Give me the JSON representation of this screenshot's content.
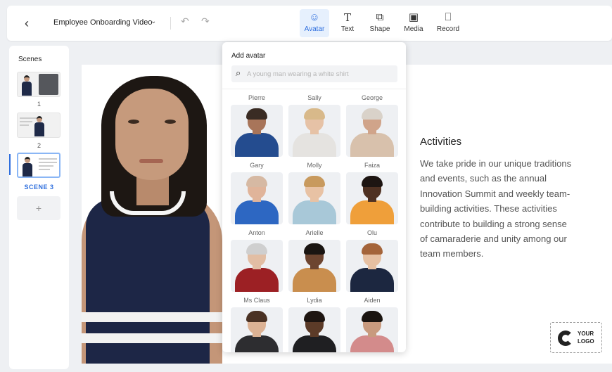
{
  "topbar": {
    "back_icon": "chevron-left-icon",
    "project_title": "Employee Onboarding Video",
    "title_dropdown_icon": "chevron-down-icon",
    "undo_icon": "undo-icon",
    "redo_icon": "redo-icon",
    "tools": [
      {
        "label": "Avatar",
        "icon": "avatar-icon",
        "active": true
      },
      {
        "label": "Text",
        "icon": "text-icon",
        "active": false
      },
      {
        "label": "Shape",
        "icon": "shape-icon",
        "active": false
      },
      {
        "label": "Media",
        "icon": "media-icon",
        "active": false
      },
      {
        "label": "Record",
        "icon": "record-icon",
        "active": false
      }
    ]
  },
  "scenes": {
    "title": "Scenes",
    "items": [
      {
        "label": "1",
        "active": false
      },
      {
        "label": "2",
        "active": false
      },
      {
        "label": "SCENE 3",
        "active": true
      }
    ],
    "add_label": "+",
    "accent_color": "#2f6fde"
  },
  "canvas": {
    "heading": "Activities",
    "body": "We take pride in our unique traditions and events, such as the annual Innovation Summit and weekly team-building activities. These activities contribute to building a strong sense of camaraderie and unity among our team members.",
    "logo_line1": "YOUR",
    "logo_line2": "LOGO"
  },
  "avatar_panel": {
    "title": "Add avatar",
    "search_icon": "search-icon",
    "search_placeholder": "A young man wearing a white shirt",
    "search_value": "",
    "avatars": [
      {
        "name": "Pierre",
        "skin": "#a8755a",
        "hair": "#3a2c24",
        "outfit": "#244c8f"
      },
      {
        "name": "Sally",
        "skin": "#e6c2a6",
        "hair": "#d8b98a",
        "outfit": "#e5e3e0"
      },
      {
        "name": "George",
        "skin": "#d0a48a",
        "hair": "#d9d2c9",
        "outfit": "#d8c1ac"
      },
      {
        "name": "Gary",
        "skin": "#e0b49a",
        "hair": "#d6b9a3",
        "outfit": "#2d67c2"
      },
      {
        "name": "Molly",
        "skin": "#e8c2a4",
        "hair": "#c89a5e",
        "outfit": "#a8c8d8"
      },
      {
        "name": "Faiza",
        "skin": "#4f3122",
        "hair": "#1d1512",
        "outfit": "#ef9f3a"
      },
      {
        "name": "Anton",
        "skin": "#e2bea4",
        "hair": "#cfcfcf",
        "outfit": "#9c2024"
      },
      {
        "name": "Arielle",
        "skin": "#6d4530",
        "hair": "#1a1512",
        "outfit": "#c98e4e"
      },
      {
        "name": "Olu",
        "skin": "#e6c0a2",
        "hair": "#a4643a",
        "outfit": "#1c2740"
      },
      {
        "name": "Ms Claus",
        "skin": "#dcb294",
        "hair": "#4a3224",
        "outfit": "#2d2d30"
      },
      {
        "name": "Lydia",
        "skin": "#5c3b28",
        "hair": "#1e1511",
        "outfit": "#1f1f22"
      },
      {
        "name": "Aiden",
        "skin": "#c89a7e",
        "hair": "#1a1410",
        "outfit": "#d38b8b"
      }
    ]
  }
}
